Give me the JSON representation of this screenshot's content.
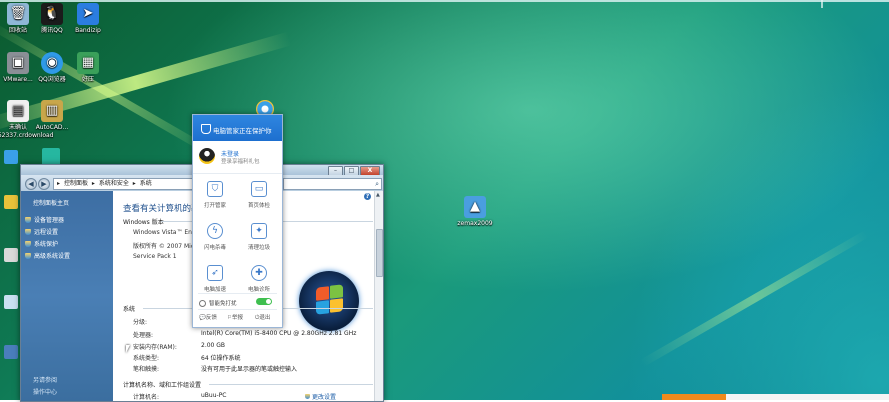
{
  "desktop": {
    "icons": [
      {
        "label": "回收站",
        "glyph": "🗑",
        "color": "#8fb7d6"
      },
      {
        "label": "腾讯QQ",
        "glyph": "🐧",
        "color": "#1b1b1b"
      },
      {
        "label": "Bandizip",
        "glyph": "➤",
        "color": "#2b7de0"
      },
      {
        "label": "VMware...",
        "glyph": "▣",
        "color": "#8a8f96"
      },
      {
        "label": "QQ浏览器",
        "glyph": "◉",
        "color": "#2f9ae8"
      },
      {
        "label": "好压",
        "glyph": "▦",
        "color": "#3aa05a"
      },
      {
        "label": "未确认 652337.crdownload",
        "glyph": "▤",
        "color": "#f0f0f0"
      },
      {
        "label": "AutoCAD...",
        "glyph": "▥",
        "color": "#c8a64a"
      },
      {
        "label": "zemax2009",
        "glyph": "▲",
        "color": "#4a9ee0"
      }
    ],
    "taskbar_accent": "#f08a1c"
  },
  "window": {
    "controls": {
      "minimize": "–",
      "maximize": "□",
      "close": "X"
    },
    "address": {
      "segments": [
        "▸",
        "控制面板",
        "▸",
        "系统和安全",
        "▸",
        "系统"
      ]
    },
    "search_glyph": "⌕",
    "sidebar": {
      "title": "控制面板主页",
      "items": [
        "设备管理器",
        "远程设置",
        "系统保护",
        "高级系统设置"
      ],
      "footer": [
        "另请参阅",
        "操作中心"
      ]
    },
    "content": {
      "heading": "查看有关计算机的基本信息",
      "edition_title": "Windows 版本",
      "edition_lines": [
        "Windows Vista™ Ente",
        "版权所有 © 2007 Micro",
        "Service Pack 1"
      ],
      "system_title": "系统",
      "rows": [
        {
          "label": "分级:",
          "value": ""
        },
        {
          "label": "处理器:",
          "value": "Intel(R) Core(TM) i5-8400 CPU @ 2.80GHz   2.81 GHz"
        },
        {
          "label": "安装内存(RAM):",
          "value": "2.00 GB"
        },
        {
          "label": "系统类型:",
          "value": "64 位操作系统"
        },
        {
          "label": "笔和触摸:",
          "value": "没有可用于此显示器的笔或触控输入"
        }
      ],
      "computer_title": "计算机名称、域和工作组设置",
      "computer_row": {
        "label": "计算机名:",
        "value": "uBuu-PC"
      },
      "change_link": "更改设置"
    }
  },
  "popup": {
    "header": "电脑管家正在保护你",
    "user_name": "未登录",
    "user_sub": "登录享福利礼包",
    "tiles": [
      {
        "label": "打开管家",
        "glyph": "⛉",
        "shape": "square"
      },
      {
        "label": "首页体检",
        "glyph": "▭",
        "shape": "square"
      },
      {
        "label": "闪电杀毒",
        "glyph": "ϟ",
        "shape": "round"
      },
      {
        "label": "清理垃圾",
        "glyph": "✦",
        "shape": "square"
      },
      {
        "label": "电脑加速",
        "glyph": "➶",
        "shape": "square"
      },
      {
        "label": "电脑诊所",
        "glyph": "✚",
        "shape": "round"
      }
    ],
    "toggle_label": "智能免打扰",
    "toggle_on": true,
    "footer": [
      "反馈",
      "举报",
      "退出"
    ]
  }
}
